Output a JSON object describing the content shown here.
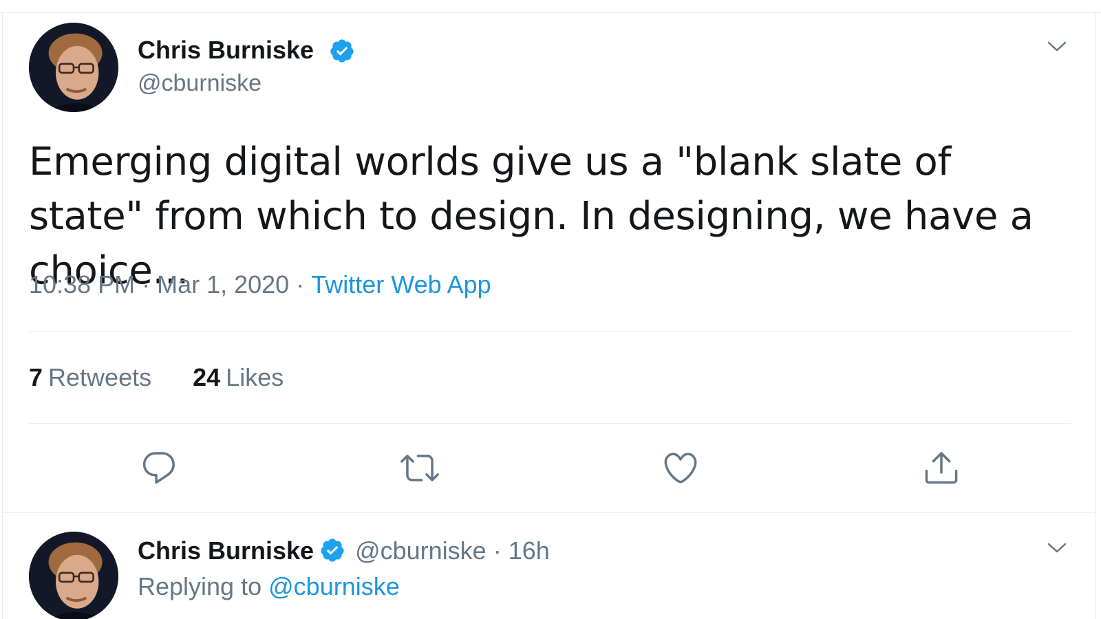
{
  "colors": {
    "text_primary": "#14171a",
    "text_secondary": "#657786",
    "link": "#1b95e0",
    "verified": "#1da1f2",
    "divider": "#e6ecf0"
  },
  "main_tweet": {
    "author_name": "Chris Burniske",
    "handle": "@cburniske",
    "verified_icon": "verified-badge-icon",
    "text": "Emerging digital worlds give us a \"blank slate of state\" from which to design. In designing, we have a choice...",
    "time": "10:38 PM",
    "separator": "·",
    "date": "Mar 1, 2020",
    "source": "Twitter Web App",
    "stats": {
      "retweets_count": "7",
      "retweets_label": "Retweets",
      "likes_count": "24",
      "likes_label": "Likes"
    },
    "actions": {
      "reply_icon": "reply-icon",
      "retweet_icon": "retweet-icon",
      "like_icon": "heart-icon",
      "share_icon": "share-icon"
    }
  },
  "reply_tweet": {
    "author_name": "Chris Burniske",
    "handle": "@cburniske",
    "separator": "·",
    "time": "16h",
    "replying_to_label": "Replying to",
    "replying_to_handle": "@cburniske"
  }
}
